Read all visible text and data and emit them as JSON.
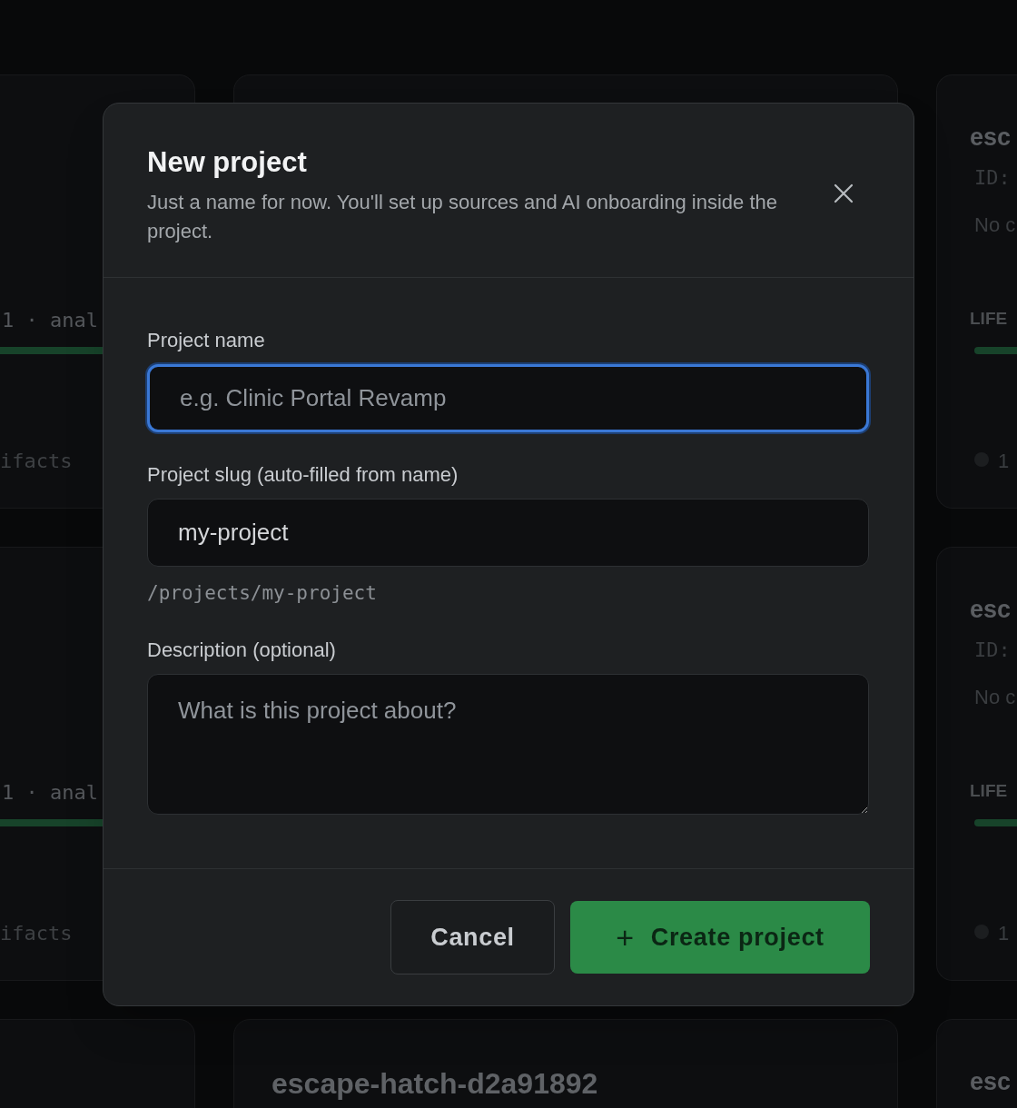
{
  "background_cards": [
    {
      "kind": "left",
      "meta": "1 · anal",
      "footer": "ifacts"
    },
    {
      "kind": "right",
      "title": "esc",
      "id": "ID:",
      "description": "No c",
      "section": "LIFE",
      "footer": "1"
    },
    {
      "kind": "left",
      "meta": "1 · anal",
      "footer": "ifacts"
    },
    {
      "kind": "right",
      "title": "esc",
      "id": "ID:",
      "description": "No c",
      "section": "LIFE",
      "footer": "1"
    },
    {
      "kind": "middle",
      "title": "escape-hatch-d2a91892"
    },
    {
      "kind": "right",
      "title": "esc"
    }
  ],
  "dialog": {
    "title": "New project",
    "subtitle": "Just a name for now. You'll set up sources and AI onboarding inside the project.",
    "fields": [
      {
        "kind": "input",
        "label": "Project name",
        "placeholder": "e.g. Clinic Portal Revamp",
        "focused": true
      },
      {
        "kind": "input",
        "label": "Project slug (auto-filled from name)",
        "value": "my-project",
        "hint": "/projects/my-project",
        "focused": false
      },
      {
        "kind": "textarea",
        "label": "Description (optional)",
        "placeholder": "What is this project about?",
        "focused": false
      }
    ],
    "buttons": [
      {
        "kind": "secondary",
        "label": "Cancel"
      },
      {
        "kind": "primary",
        "icon": "+",
        "label": "Create project"
      }
    ]
  }
}
